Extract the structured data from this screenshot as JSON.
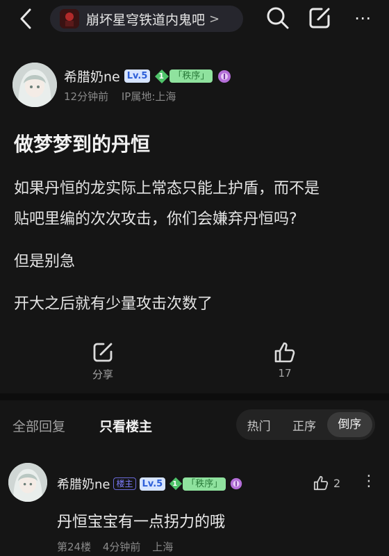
{
  "topbar": {
    "forum_name": "崩坏星穹铁道内鬼吧",
    "forum_chevron": ">",
    "more_label": "⋯"
  },
  "post": {
    "author": "希腊奶ne",
    "level": "Lv.5",
    "badge_level": "1",
    "badge_title": "「秩序」",
    "time": "12分钟前",
    "ip": "IP属地:上海",
    "title": "做梦梦到的丹恒",
    "paragraphs": [
      "如果丹恒的龙实际上常态只能上护盾，而不是",
      "贴吧里编的次次攻击，你们会嫌弃丹恒吗?",
      "但是别急",
      "开大之后就有少量攻击次数了"
    ],
    "share_label": "分享",
    "like_count": "17"
  },
  "replies_bar": {
    "all_label": "全部回复",
    "host_only_label": "只看楼主",
    "sort_hot": "热门",
    "sort_asc": "正序",
    "sort_desc": "倒序"
  },
  "comment": {
    "author": "希腊奶ne",
    "host_tag": "楼主",
    "level": "Lv.5",
    "badge_level": "1",
    "badge_title": "「秩序」",
    "text": "丹恒宝宝有一点拐力的哦",
    "floor": "第24楼",
    "time": "4分钟前",
    "location": "上海",
    "like_count": "2",
    "more_label": "⋮"
  },
  "colors": {
    "background": "#151515",
    "level_badge_bg": "#d6e4ff",
    "order_badge_bg": "#8fe29e",
    "host_tag": "#7d7dff"
  }
}
